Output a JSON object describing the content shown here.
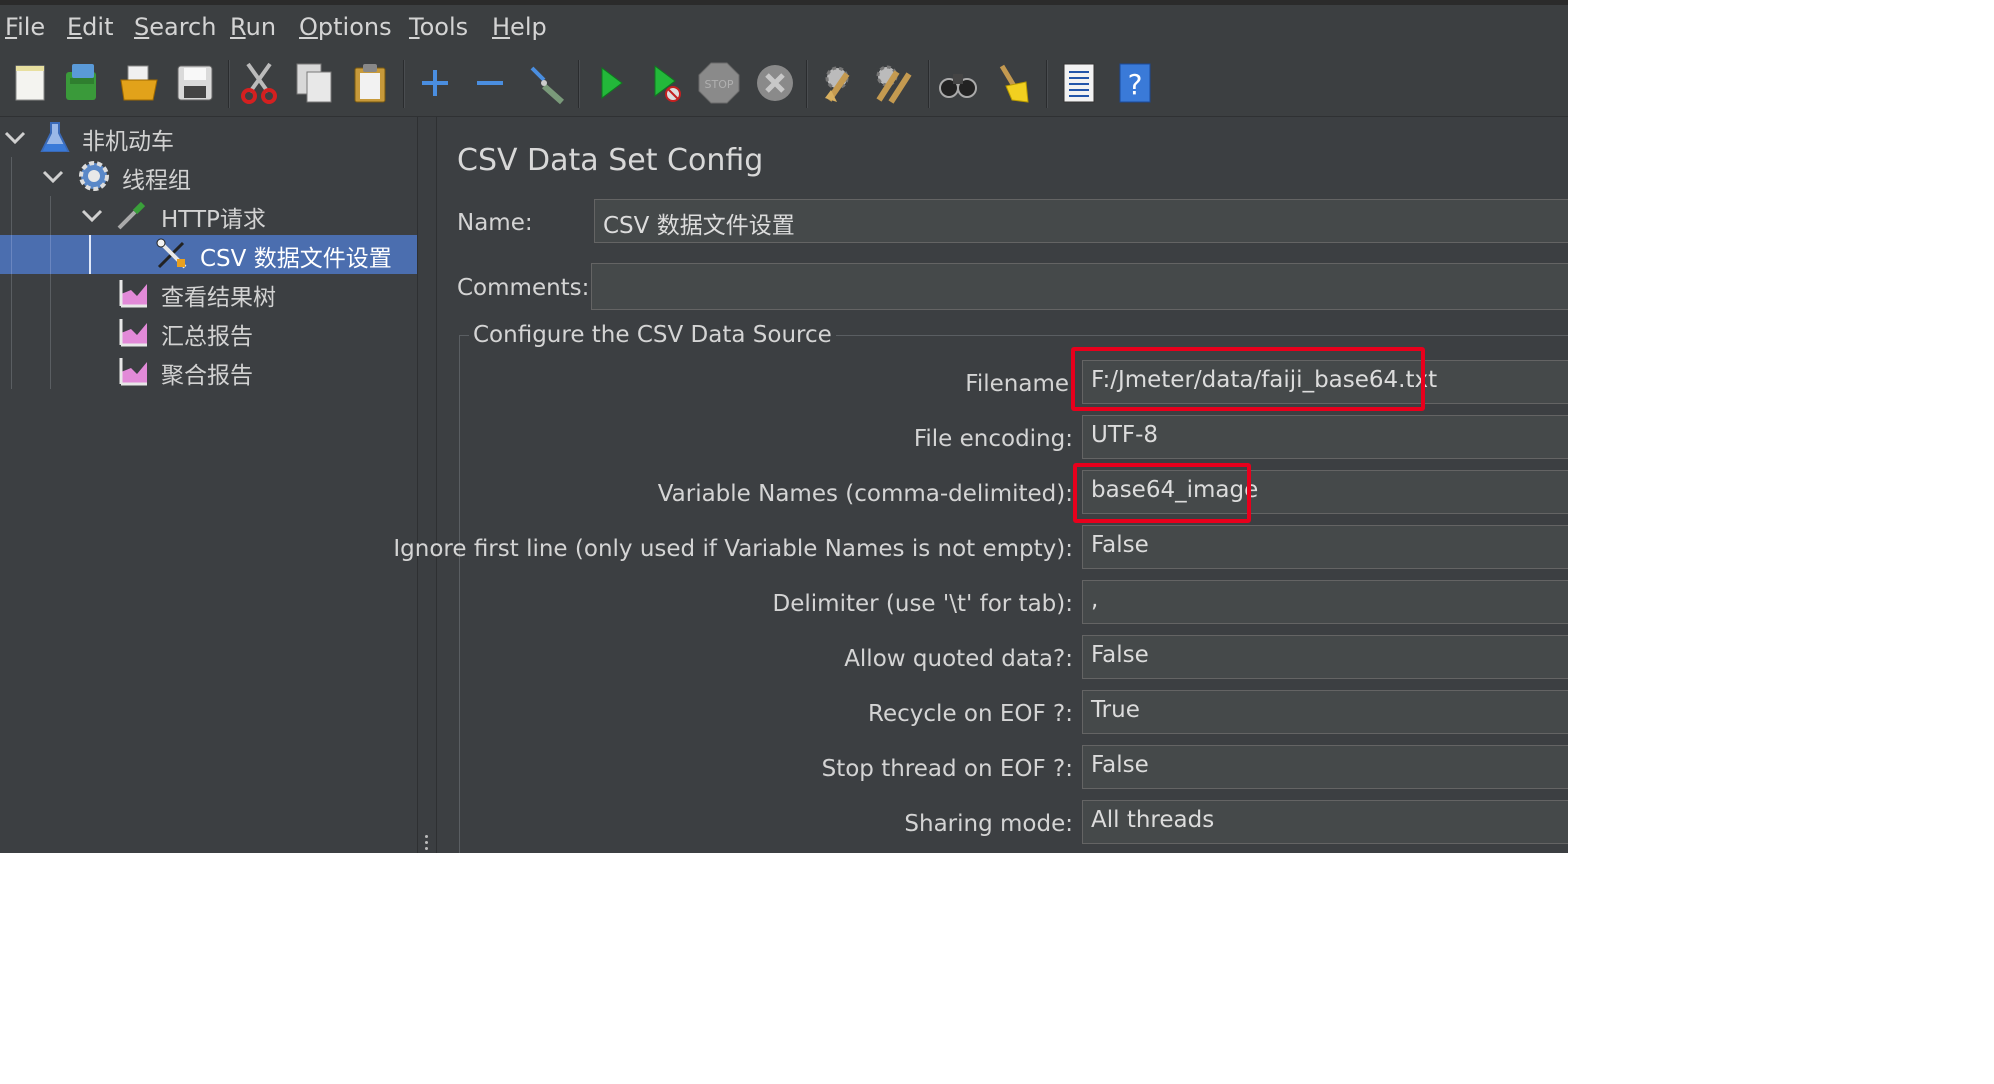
{
  "menu": {
    "items": [
      {
        "mnemonic": "F",
        "rest": "ile"
      },
      {
        "mnemonic": "E",
        "rest": "dit"
      },
      {
        "mnemonic": "S",
        "rest": "earch"
      },
      {
        "mnemonic": "R",
        "rest": "un"
      },
      {
        "mnemonic": "O",
        "rest": "ptions"
      },
      {
        "mnemonic": "T",
        "rest": "ools"
      },
      {
        "mnemonic": "H",
        "rest": "elp"
      }
    ]
  },
  "toolbar": {
    "icons": [
      "new-icon",
      "templates-icon",
      "open-icon",
      "save-icon",
      "cut-icon",
      "copy-icon",
      "paste-icon",
      "expand-icon",
      "collapse-icon",
      "toggle-icon",
      "start-icon",
      "start-no-timers-icon",
      "stop-icon",
      "shutdown-icon",
      "clear-icon",
      "clear-all-icon",
      "search-icon",
      "reset-search-icon",
      "function-helper-icon",
      "help-icon"
    ],
    "stop_text": "STOP"
  },
  "tree": {
    "items": [
      {
        "label": "非机动车",
        "icon": "test-plan-icon"
      },
      {
        "label": "线程组",
        "icon": "thread-group-icon"
      },
      {
        "label": "HTTP请求",
        "icon": "http-sampler-icon"
      },
      {
        "label": "CSV 数据文件设置",
        "icon": "config-element-icon",
        "selected": true
      },
      {
        "label": "查看结果树",
        "icon": "listener-icon"
      },
      {
        "label": "汇总报告",
        "icon": "listener-icon"
      },
      {
        "label": "聚合报告",
        "icon": "listener-icon"
      }
    ]
  },
  "main": {
    "title": "CSV Data Set Config",
    "name_label": "Name:",
    "name_value": "CSV 数据文件设置",
    "comments_label": "Comments:",
    "comments_value": "",
    "group_title": "Configure the CSV Data Source",
    "fields": [
      {
        "label": "Filename",
        "value": "F:/Jmeter/data/faiji_base64.txt"
      },
      {
        "label": "File encoding:",
        "value": "UTF-8"
      },
      {
        "label": "Variable Names (comma-delimited):",
        "value": "base64_image"
      },
      {
        "label": "Ignore first line (only used if Variable Names is not empty):",
        "value": "False"
      },
      {
        "label": "Delimiter (use '\\t' for tab):",
        "value": ","
      },
      {
        "label": "Allow quoted data?:",
        "value": "False"
      },
      {
        "label": "Recycle on EOF ?:",
        "value": "True"
      },
      {
        "label": "Stop thread on EOF ?:",
        "value": "False"
      },
      {
        "label": "Sharing mode:",
        "value": "All threads"
      }
    ]
  },
  "colors": {
    "highlight": "#e8001c",
    "selection": "#4b6eaf",
    "background": "#3c3f42"
  }
}
